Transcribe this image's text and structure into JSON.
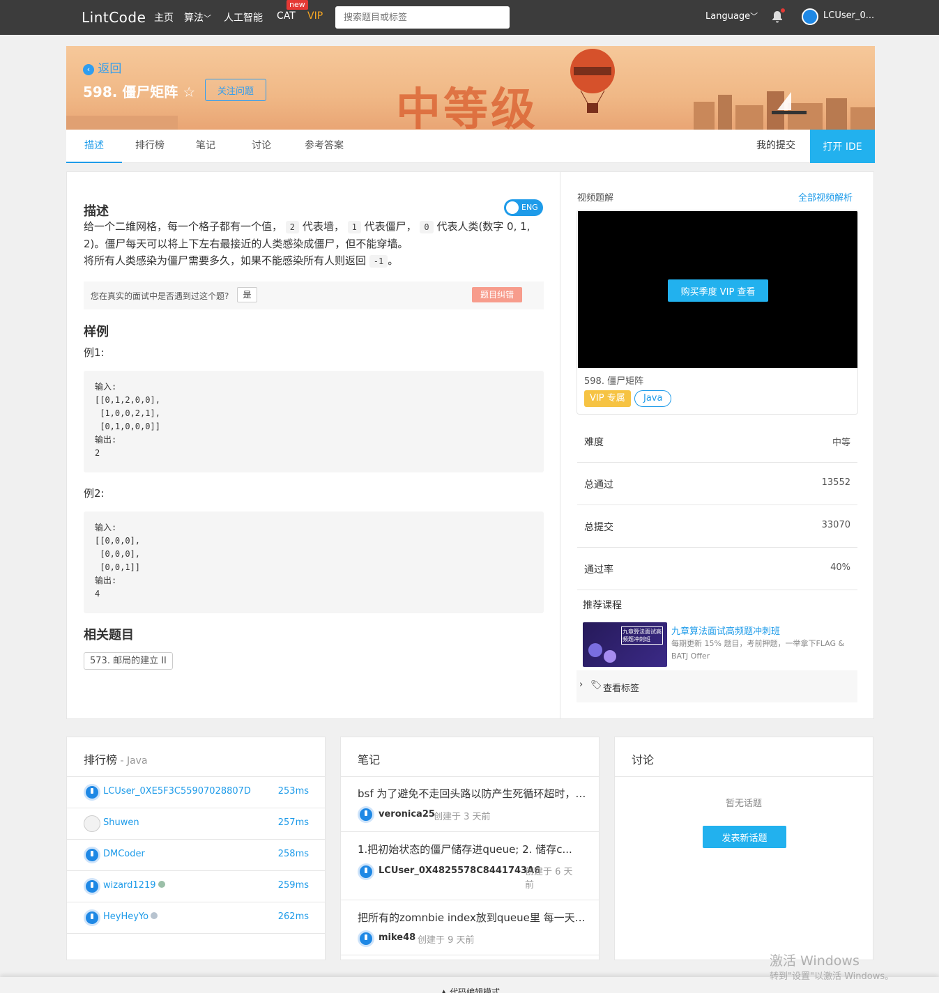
{
  "topbar": {
    "logo": "LintCode",
    "nav": [
      "主页",
      "算法",
      "人工智能",
      "CAT",
      "VIP"
    ],
    "new_badge": "new",
    "search_placeholder": "搜索题目或标签",
    "language": "Language",
    "username": "LCUser_0..."
  },
  "banner": {
    "back": "返回",
    "title": "598. 僵尸矩阵",
    "follow": "关注问题",
    "level": "中等级"
  },
  "tabs": [
    "描述",
    "排行榜",
    "笔记",
    "讨论",
    "参考答案"
  ],
  "my_submissions": "我的提交",
  "open_ide": "打开 IDE",
  "problem": {
    "desc_heading": "描述",
    "eng": "ENG",
    "desc_parts": [
      "给一个二维网格，每一个格子都有一个值，",
      "2",
      "代表墙，",
      "1",
      "代表僵尸，",
      "0",
      "代表人类(数字 0, 1, 2)。僵尸每天可以将上下左右最接近的人类感染成僵尸，但不能穿墙。",
      "将所有人类感染为僵尸需要多久，如果不能感染所有人则返回",
      "-1",
      "。"
    ],
    "met_question": "您在真实的面试中是否遇到过这个题?",
    "yes": "是",
    "report_error": "题目纠错",
    "sample_heading": "样例",
    "example1_label": "例1:",
    "example1_code": "输入:\n[[0,1,2,0,0],\n [1,0,0,2,1],\n [0,1,0,0,0]]\n输出:\n2",
    "example2_label": "例2:",
    "example2_code": "输入:\n[[0,0,0],\n [0,0,0],\n [0,0,1]]\n输出:\n4",
    "related_heading": "相关题目",
    "related": "573. 邮局的建立 II"
  },
  "sidebar": {
    "video_heading": "视频题解",
    "all_videos": "全部视频解析",
    "buy_vip": "购买季度 VIP 查看",
    "video_title": "598. 僵尸矩阵",
    "vip_tag": "VIP 专属",
    "lang_tag": "Java",
    "stats": [
      {
        "k": "难度",
        "v": "中等"
      },
      {
        "k": "总通过",
        "v": "13552"
      },
      {
        "k": "总提交",
        "v": "33070"
      },
      {
        "k": "通过率",
        "v": "40%"
      }
    ],
    "recommend_heading": "推荐课程",
    "course_image_text": "九章算法面试高频题冲刺班",
    "course_title": "九章算法面试高频题冲刺班",
    "course_desc": "每期更新 15% 题目，考前押题，一举拿下FLAG & BATJ Offer",
    "view_tags": "查看标签"
  },
  "leaderboard": {
    "heading": "排行榜",
    "lang": " - Java",
    "rows": [
      {
        "name": "LCUser_0XE5F3C55907028807D",
        "time": "253ms"
      },
      {
        "name": "Shuwen",
        "time": "257ms"
      },
      {
        "name": "DMCoder",
        "time": "258ms"
      },
      {
        "name": "wizard1219",
        "time": "259ms"
      },
      {
        "name": "HeyHeyYo",
        "time": "262ms"
      }
    ]
  },
  "notes": {
    "heading": "笔记",
    "rows": [
      {
        "title": "bsf 为了避免不走回头路以防产生死循环超时，要将访问过的节点",
        "user": "veronica25",
        "time": "创建于 3 天前"
      },
      {
        "title": "1.把初始状态的僵尸储存进queue; 2. 储存c...",
        "user": "LCUser_0X4825578C8441743A6",
        "time": "创建于 6 天前"
      },
      {
        "title": "把所有的zomnbie index放到queue里 每一天扩展一层",
        "user": "mike48",
        "time": "创建于 9 天前"
      }
    ]
  },
  "discuss": {
    "heading": "讨论",
    "empty": "暂无话题",
    "new_topic": "发表新话题"
  },
  "bottom": {
    "code_mode": "代码编辑模式"
  },
  "watermark": {
    "line1": "激活 Windows",
    "line2": "转到\"设置\"以激活 Windows。"
  }
}
